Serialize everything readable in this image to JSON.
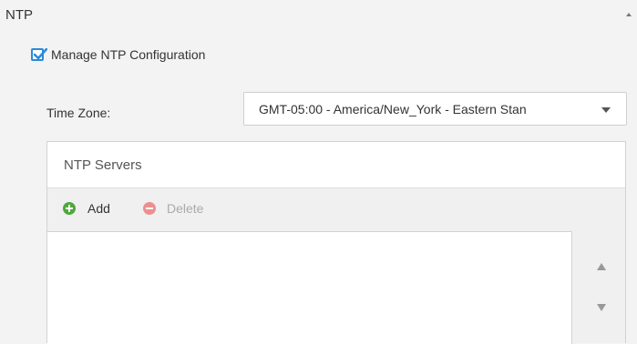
{
  "section": {
    "title": "NTP"
  },
  "manage": {
    "label": "Manage NTP Configuration",
    "checked": true
  },
  "time_zone": {
    "label": "Time Zone:",
    "value": "GMT-05:00 - America/New_York - Eastern Stan"
  },
  "servers": {
    "title": "NTP Servers",
    "add_label": "Add",
    "delete_label": "Delete",
    "items": []
  },
  "icons": {
    "collapse": "chevron-up-icon",
    "checkbox": "checkmark-icon",
    "dropdown": "caret-down-icon",
    "add": "plus-circle-icon",
    "delete": "minus-circle-icon",
    "up": "arrow-up-icon",
    "down": "arrow-down-icon"
  },
  "colors": {
    "accent": "#2c8ad8",
    "add": "#4ea83b",
    "delete": "#ee8f8f"
  }
}
